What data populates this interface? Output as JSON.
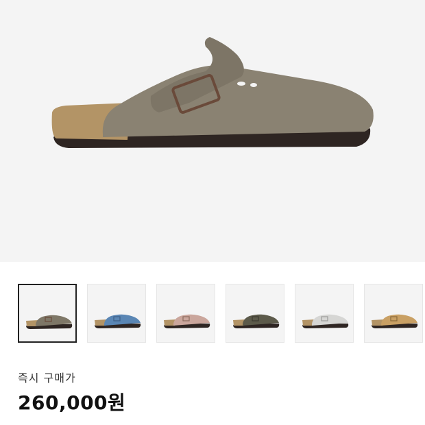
{
  "product": {
    "main_image": {
      "icon": "clog-shoe-image",
      "upper_color": "#8a8272",
      "strap_color": "#7d7566",
      "cork_color": "#b39466",
      "sole_color": "#2e2522",
      "buckle_color": "#6a4a3a"
    },
    "thumbnails": [
      {
        "icon": "clog-thumbnail-taupe",
        "color": "#7e7767",
        "selected": true
      },
      {
        "icon": "clog-thumbnail-blue",
        "color": "#5a86b4",
        "selected": false
      },
      {
        "icon": "clog-thumbnail-pink",
        "color": "#caa69c",
        "selected": false
      },
      {
        "icon": "clog-thumbnail-olive",
        "color": "#5c5a4a",
        "selected": false
      },
      {
        "icon": "clog-thumbnail-grey",
        "color": "#d6d6d4",
        "selected": false
      },
      {
        "icon": "clog-thumbnail-tan",
        "color": "#c9a064",
        "selected": false
      }
    ]
  },
  "pricing": {
    "label": "즉시 구매가",
    "price": "260,000원"
  }
}
